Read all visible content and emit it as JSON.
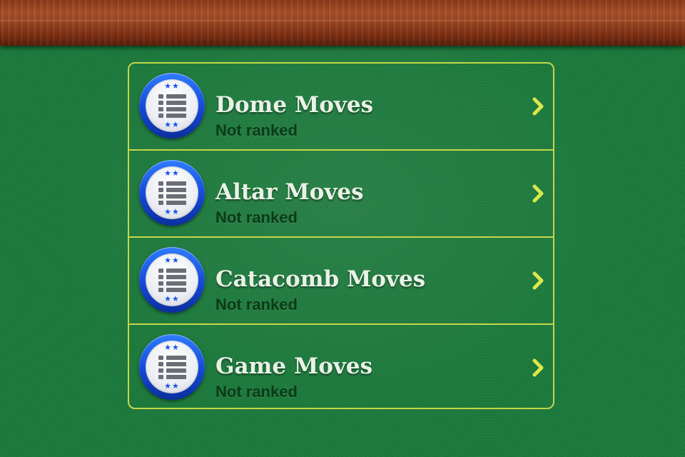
{
  "colors": {
    "felt": "#1c7a3c",
    "panel_border": "#c4d74a",
    "badge_blue": "#1448d6",
    "title_text": "#e9f1e6",
    "subtitle_text": "#0b3a17",
    "chevron": "#d9e84a"
  },
  "leaderboards": [
    {
      "icon": "leaderboard-list-icon",
      "title": "Dome Moves",
      "subtitle": "Not ranked",
      "chevron": "chevron-right-icon"
    },
    {
      "icon": "leaderboard-list-icon",
      "title": "Altar Moves",
      "subtitle": "Not ranked",
      "chevron": "chevron-right-icon"
    },
    {
      "icon": "leaderboard-list-icon",
      "title": "Catacomb Moves",
      "subtitle": "Not ranked",
      "chevron": "chevron-right-icon"
    },
    {
      "icon": "leaderboard-list-icon",
      "title": "Game Moves",
      "subtitle": "Not ranked",
      "chevron": "chevron-right-icon"
    }
  ]
}
